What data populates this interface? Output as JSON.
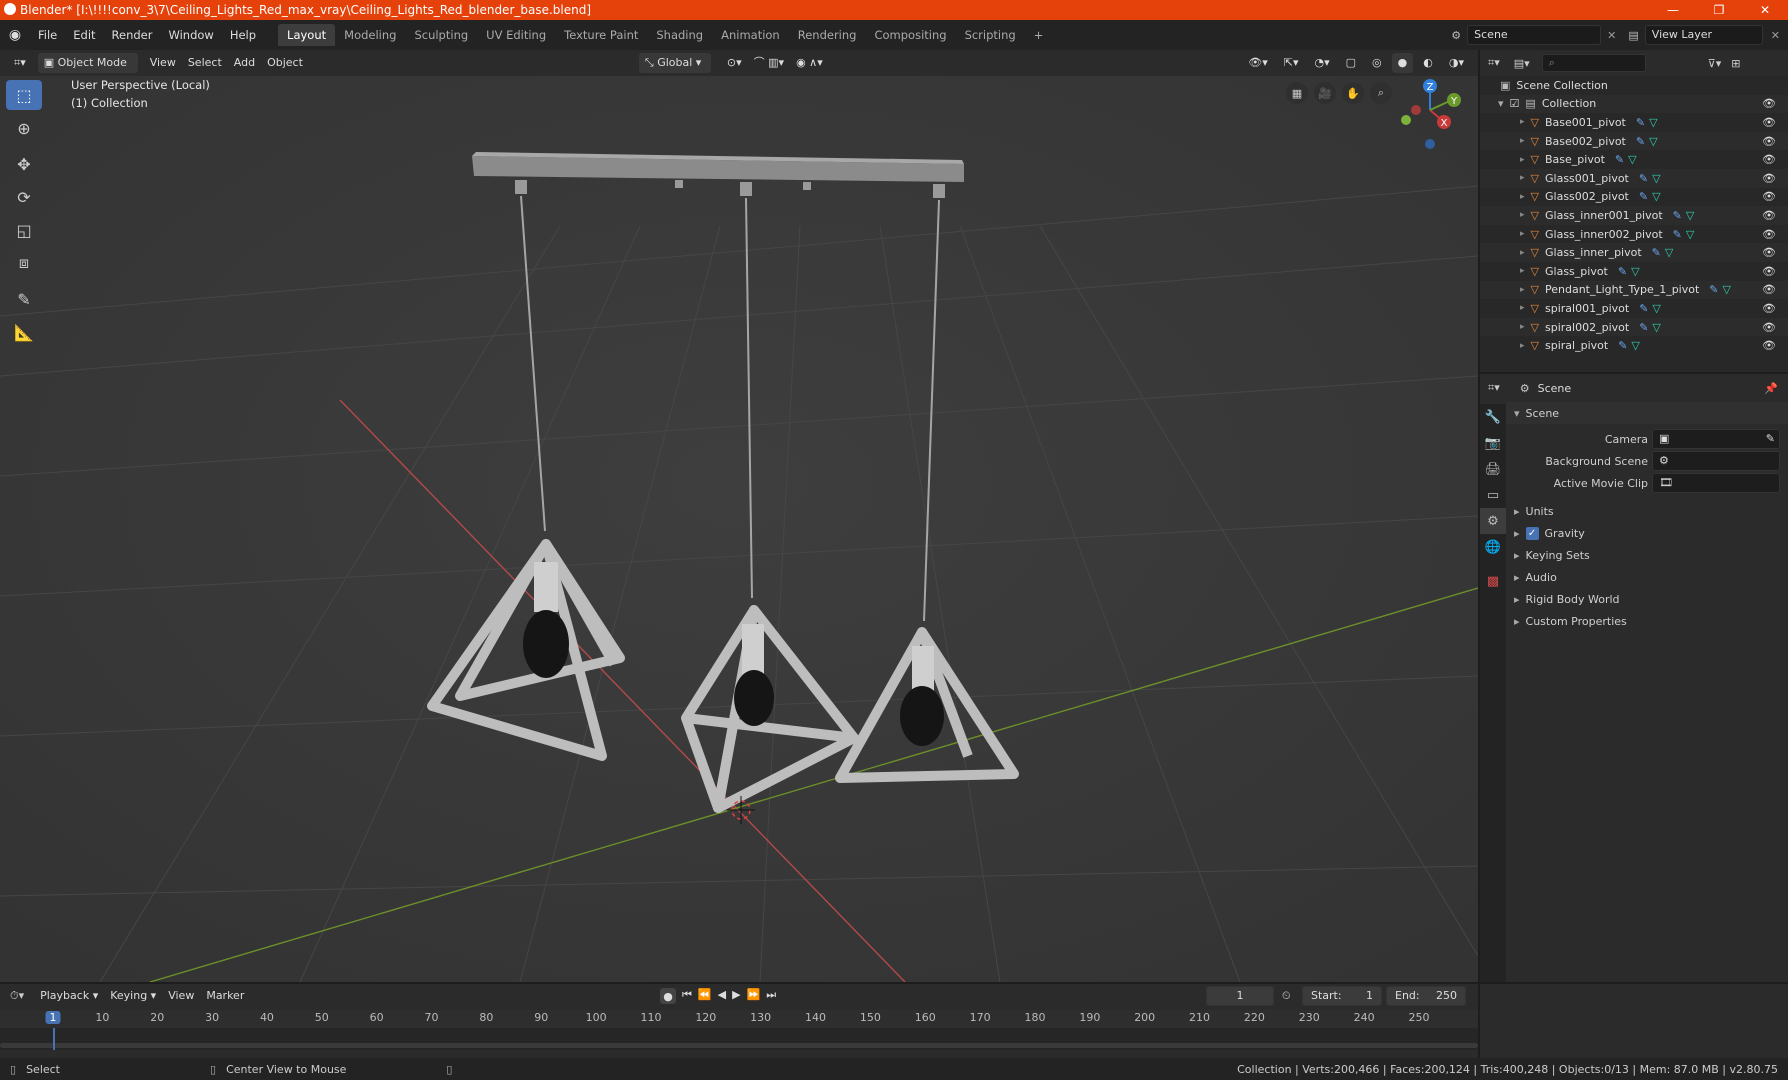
{
  "window": {
    "title": "Blender* [I:\\!!!!conv_3\\7\\Ceiling_Lights_Red_max_vray\\Ceiling_Lights_Red_blender_base.blend]"
  },
  "menu": {
    "items": [
      "File",
      "Edit",
      "Render",
      "Window",
      "Help"
    ]
  },
  "workspaces": {
    "tabs": [
      "Layout",
      "Modeling",
      "Sculpting",
      "UV Editing",
      "Texture Paint",
      "Shading",
      "Animation",
      "Rendering",
      "Compositing",
      "Scripting"
    ],
    "active": "Layout"
  },
  "scene_field": "Scene",
  "viewlayer_field": "View Layer",
  "viewport_header": {
    "mode": "Object Mode",
    "menus": [
      "View",
      "Select",
      "Add",
      "Object"
    ],
    "orientation": "Global"
  },
  "viewport": {
    "perspective": "User Perspective (Local)",
    "collection": "(1) Collection"
  },
  "gizmo": {
    "x": "X",
    "y": "Y",
    "z": "Z"
  },
  "outliner": {
    "root": "Scene Collection",
    "collection": "Collection",
    "items": [
      "Base001_pivot",
      "Base002_pivot",
      "Base_pivot",
      "Glass001_pivot",
      "Glass002_pivot",
      "Glass_inner001_pivot",
      "Glass_inner002_pivot",
      "Glass_inner_pivot",
      "Glass_pivot",
      "Pendant_Light_Type_1_pivot",
      "spiral001_pivot",
      "spiral002_pivot",
      "spiral_pivot"
    ]
  },
  "properties": {
    "context": "Scene",
    "section": "Scene",
    "fields": {
      "camera": "Camera",
      "background": "Background Scene",
      "movieclip": "Active Movie Clip"
    },
    "panels": [
      "Units",
      "Gravity",
      "Keying Sets",
      "Audio",
      "Rigid Body World",
      "Custom Properties"
    ],
    "gravity_checked": true
  },
  "timeline": {
    "menus": [
      "Playback",
      "Keying",
      "View",
      "Marker"
    ],
    "current_frame": "1",
    "start_label": "Start:",
    "start": "1",
    "end_label": "End:",
    "end": "250",
    "ticks": [
      "1",
      "10",
      "20",
      "30",
      "40",
      "50",
      "60",
      "70",
      "80",
      "90",
      "100",
      "110",
      "120",
      "130",
      "140",
      "150",
      "160",
      "170",
      "180",
      "190",
      "200",
      "210",
      "220",
      "230",
      "240",
      "250"
    ]
  },
  "statusbar": {
    "left": "Select",
    "middle": "Center View to Mouse",
    "right": "Collection | Verts:200,466 | Faces:200,124 | Tris:400,248 | Objects:0/13 | Mem: 87.0 MB | v2.80.75"
  },
  "colors": {
    "title_bar": "#e5410b",
    "accent": "#4772b3",
    "x_axis": "#c83a3a",
    "y_axis": "#6a9a2a",
    "z_axis": "#2f7fdc"
  }
}
